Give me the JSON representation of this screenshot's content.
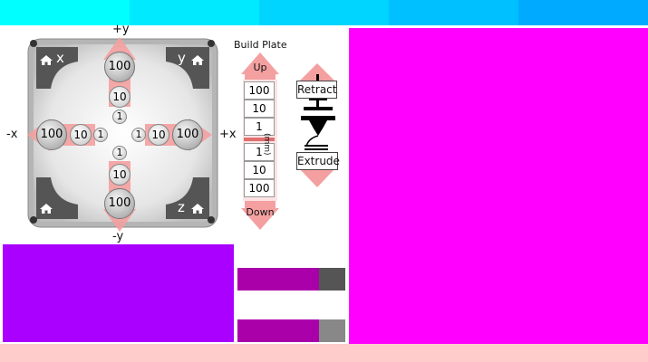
{
  "top_strip": {
    "colors": [
      "#00ffff",
      "#00eaff",
      "#00d5ff",
      "#00c0ff",
      "#00abff"
    ]
  },
  "panels": {
    "left_bottom_color": "#aa00ff",
    "right_color": "#ff00ff",
    "footer_color": "#ffcccc",
    "bar1_colors": [
      "#aa00aa",
      "#555555"
    ],
    "bar2_colors": [
      "#aa00aa",
      "#888888"
    ]
  },
  "jog": {
    "axis_labels": {
      "plus_y": "+y",
      "minus_y": "-y",
      "minus_x": "-x",
      "plus_x": "+x"
    },
    "corners": {
      "top_left": "x",
      "top_right": "y",
      "bottom_left": "",
      "bottom_right": "z"
    },
    "steps": {
      "large": "100",
      "medium": "10",
      "small": "1"
    }
  },
  "build_plate": {
    "title": "Build Plate",
    "up_label": "Up",
    "down_label": "Down",
    "steps_up": [
      "100",
      "10",
      "1"
    ],
    "steps_down": [
      "1",
      "10",
      "100"
    ],
    "unit_label": "(mm)"
  },
  "extruder": {
    "retract_label": "Retract",
    "extrude_label": "Extrude"
  }
}
